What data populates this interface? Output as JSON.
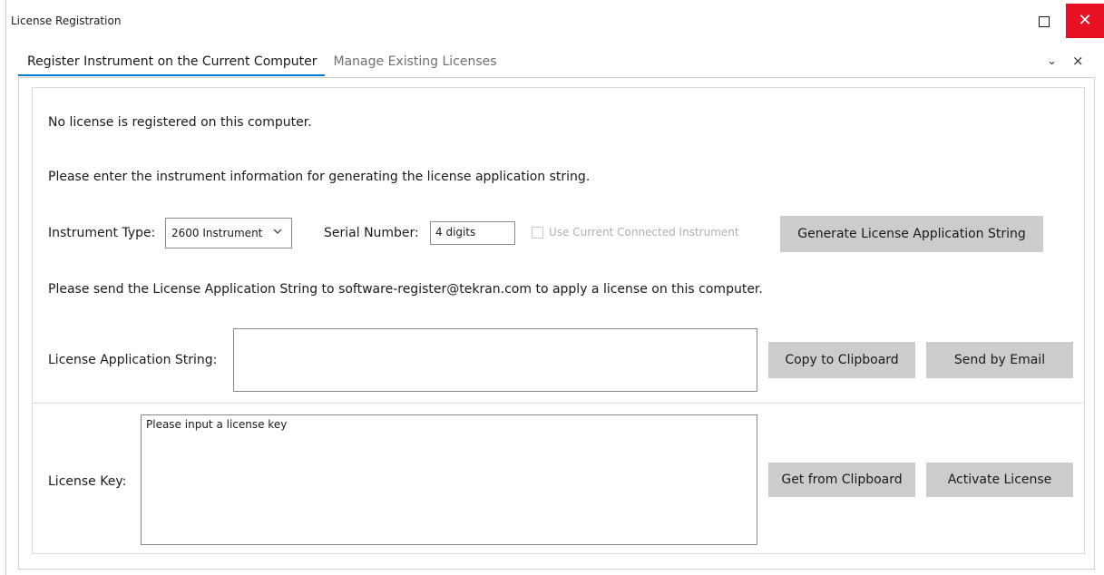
{
  "window": {
    "title": "License Registration",
    "close_glyph": "✕"
  },
  "tabs": [
    {
      "label": "Register Instrument on the Current Computer",
      "active": true
    },
    {
      "label": "Manage Existing Licenses",
      "active": false
    }
  ],
  "tab_controls": {
    "dropdown_glyph": "⌄",
    "close_glyph": "×"
  },
  "register": {
    "status_text": "No license is registered on this computer.",
    "instruction_text": "Please enter the instrument information for generating the license application string.",
    "instrument_type_label": "Instrument Type:",
    "instrument_type_value": "2600 Instrument",
    "serial_number_label": "Serial Number:",
    "serial_number_value": "4 digits",
    "use_connected_label": "Use Current Connected Instrument",
    "use_connected_checked": false,
    "generate_button": "Generate License Application String",
    "send_instruction": "Please send the License Application String to software-register@tekran.com to apply a license on this computer.",
    "application_string_label": "License Application String:",
    "application_string_value": "",
    "copy_button": "Copy to Clipboard",
    "email_button": "Send by Email",
    "license_key_label": "License Key:",
    "license_key_placeholder": "Please input a license key",
    "get_clipboard_button": "Get from Clipboard",
    "activate_button": "Activate License"
  },
  "colors": {
    "accent": "#0078d4",
    "close_red": "#e81123",
    "button_gray": "#cccccc"
  }
}
